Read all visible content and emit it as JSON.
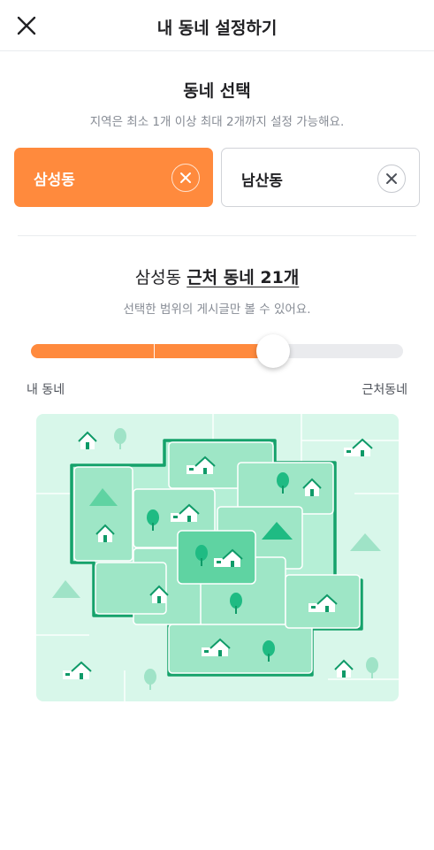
{
  "header": {
    "title": "내 동네 설정하기",
    "close_icon": "close-icon"
  },
  "neighborhood": {
    "title": "동네 선택",
    "subtitle": "지역은 최소 1개 이상 최대 2개까지 설정 가능해요.",
    "chips": [
      {
        "label": "삼성동",
        "selected": true
      },
      {
        "label": "남산동",
        "selected": false
      }
    ]
  },
  "range": {
    "name": "삼성동",
    "link": "근처 동네 21개",
    "subtitle": "선택한 범위의 게시글만 볼 수 있어요.",
    "slider_value_percent": 65,
    "slider_tick_percent": 33,
    "min_label": "내 동네",
    "max_label": "근처동네"
  },
  "colors": {
    "accent": "#ff8a3d",
    "map_bg": "#d8f7ea",
    "map_border": "#18a36f"
  }
}
